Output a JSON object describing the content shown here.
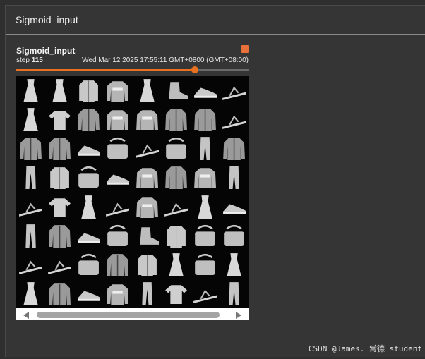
{
  "panel": {
    "title": "Sigmoid_input"
  },
  "card": {
    "title": "Sigmoid_input",
    "step_label": "step",
    "step_value": "115",
    "timestamp": "Wed Mar 12 2025 17:55:11 GMT+0800 (GMT+08:00)",
    "slider_fraction": 0.77
  },
  "image_grid": {
    "rows": 8,
    "cols": 8,
    "items": [
      "dress",
      "dress",
      "shirt",
      "pullover",
      "dress",
      "ankle-boot",
      "sneaker",
      "sandal",
      "dress",
      "t-shirt",
      "coat",
      "pullover",
      "pullover",
      "coat",
      "coat",
      "sandal",
      "coat",
      "coat",
      "sneaker",
      "bag",
      "sandal",
      "bag",
      "trouser",
      "coat",
      "trouser",
      "shirt",
      "bag",
      "sneaker",
      "pullover",
      "coat",
      "pullover",
      "trouser",
      "sandal",
      "t-shirt",
      "dress",
      "sandal",
      "pullover",
      "sandal",
      "dress",
      "sneaker",
      "trouser",
      "coat",
      "sneaker",
      "bag",
      "ankle-boot",
      "shirt",
      "bag",
      "bag",
      "sandal",
      "sandal",
      "bag",
      "coat",
      "shirt",
      "dress",
      "bag",
      "dress",
      "dress",
      "coat",
      "sneaker",
      "pullover",
      "trouser",
      "t-shirt",
      "sandal",
      "trouser"
    ]
  },
  "watermark": "CSDN @James. 常德 student"
}
